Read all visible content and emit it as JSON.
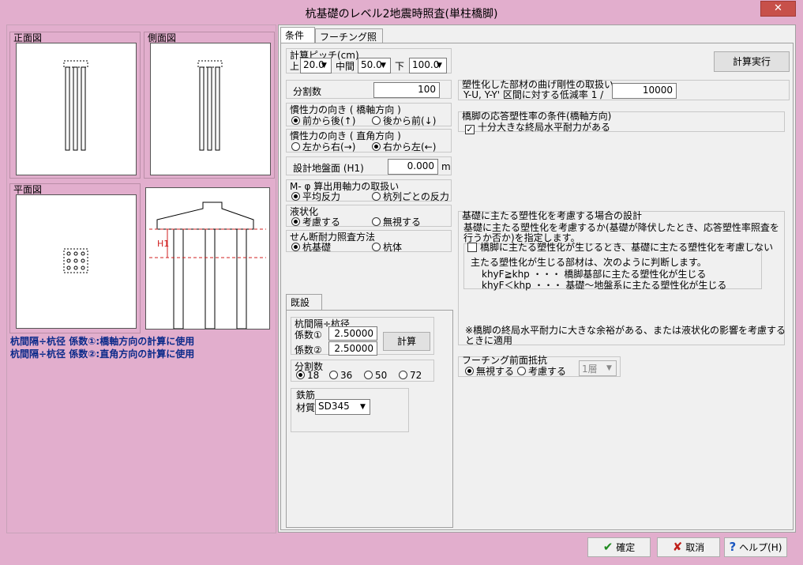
{
  "window": {
    "title": "杭基礎のレベル2地震時照査(単柱橋脚)",
    "close_glyph": "✕"
  },
  "left": {
    "front_label": "正面図",
    "side_label": "側面図",
    "plan_label": "平面図",
    "diagram_h1": "H1",
    "note1": "杭間隔÷杭径 係数①:橋軸方向の計算に使用",
    "note2": "杭間隔÷杭径 係数②:直角方向の計算に使用"
  },
  "tabs": [
    {
      "label": "条件"
    },
    {
      "label": "フーチング照査"
    }
  ],
  "conditions": {
    "pitch": {
      "label": "計算ピッチ(cm)",
      "top_label": "上",
      "top_value": "20.0",
      "mid_label": "中間",
      "mid_value": "50.0",
      "bottom_label": "下",
      "bottom_value": "100.0"
    },
    "divisions": {
      "label": "分割数",
      "value": "100"
    },
    "inertia_axial": {
      "label": "慣性力の向き ( 橋軸方向 )",
      "opt1": "前から後(↑)",
      "opt2": "後から前(↓)"
    },
    "inertia_perp": {
      "label": "慣性力の向き ( 直角方向 )",
      "opt1": "左から右(→)",
      "opt2": "右から左(←)"
    },
    "ground": {
      "label": "設計地盤面 (H1)",
      "value": "0.000",
      "unit": "m"
    },
    "mphi": {
      "label": "M- φ 算出用軸力の取扱い",
      "opt1": "平均反力",
      "opt2": "杭列ごとの反力"
    },
    "liquefaction": {
      "label": "液状化",
      "opt1": "考慮する",
      "opt2": "無視する"
    },
    "shear": {
      "label": "せん断耐力照査方法",
      "opt1": "杭基礎",
      "opt2": "杭体"
    }
  },
  "calc_button": "計算実行",
  "stiffness": {
    "label": "塑性化した部材の曲げ剛性の取扱い",
    "text": "Y-U, Y-Y' 区間に対する低減率  1 /",
    "value": "10000"
  },
  "ductility": {
    "label": "橋脚の応答塑性率の条件(橋軸方向)",
    "check_label": "十分大きな終局水平耐力がある"
  },
  "foundation": {
    "label": "基礎に主たる塑性化を考慮する場合の設計",
    "line1": "基礎に主たる塑性化を考慮するか(基礎が降伏したとき、応答塑性率照査を",
    "line2": "行うか否か)を指定します。",
    "check_label": "橋脚に主たる塑性化が生じるとき、基礎に主たる塑性化を考慮しない",
    "judge": "主たる塑性化が生じる部材は、次のように判断します。",
    "rule1": "khyF≧khp ・・・ 橋脚基部に主たる塑性化が生じる",
    "rule2": "khyF＜khp ・・・ 基礎～地盤系に主たる塑性化が生じる",
    "note1": "※橋脚の終局水平耐力に大きな余裕がある、または液状化の影響を考慮する",
    "note2": "ときに適用"
  },
  "footing_resist": {
    "label": "フーチング前面抵抗",
    "opt1": "無視する",
    "opt2": "考慮する",
    "layer_value": "1層"
  },
  "existing": {
    "tab_label": "既設杭",
    "ratio_label": "杭間隔÷杭径",
    "coef1_label": "係数①",
    "coef1_value": "2.50000",
    "coef2_label": "係数②",
    "coef2_value": "2.50000",
    "calc_label": "計算",
    "div_label": "分割数",
    "div_opts": [
      "18",
      "36",
      "50",
      "72"
    ],
    "rebar_label": "鉄筋",
    "material_label": "材質",
    "material_value": "SD345"
  },
  "footer": {
    "ok": "確定",
    "cancel": "取消",
    "help": "ヘルプ(H)"
  },
  "colors": {
    "window_bg": "#e2aecd",
    "panel_bg": "#f0f0f0",
    "note_blue": "#0b2a8a",
    "ok_green": "#1f8a1f",
    "cancel_red": "#c0201a",
    "help_blue": "#1a56c0"
  }
}
